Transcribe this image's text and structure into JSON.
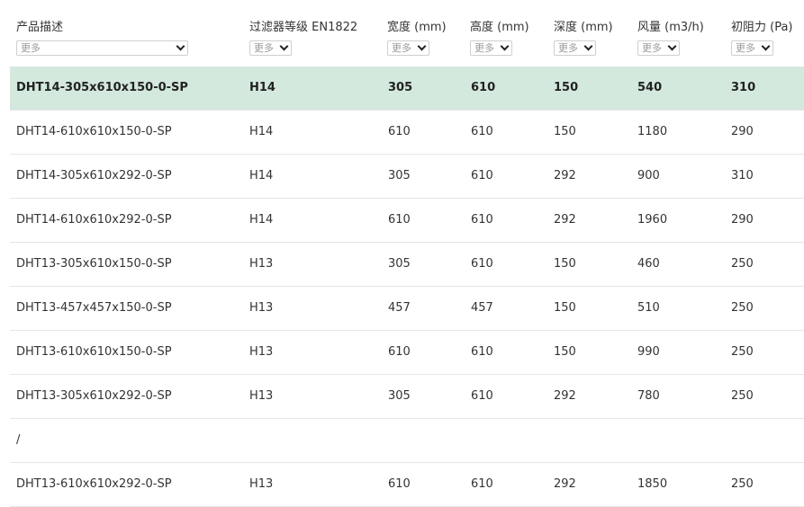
{
  "columns": [
    {
      "title": "产品描述",
      "filter": "更多"
    },
    {
      "title": "过滤器等级 EN1822",
      "filter": "更多"
    },
    {
      "title": "宽度 (mm)",
      "filter": "更多"
    },
    {
      "title": "高度 (mm)",
      "filter": "更多"
    },
    {
      "title": "深度 (mm)",
      "filter": "更多"
    },
    {
      "title": "风量 (m3/h)",
      "filter": "更多"
    },
    {
      "title": "初阻力 (Pa)",
      "filter": "更多"
    }
  ],
  "rows": [
    [
      "DHT14-305x610x150-0-SP",
      "H14",
      "305",
      "610",
      "150",
      "540",
      "310"
    ],
    [
      "DHT14-610x610x150-0-SP",
      "H14",
      "610",
      "610",
      "150",
      "1180",
      "290"
    ],
    [
      "DHT14-305x610x292-0-SP",
      "H14",
      "305",
      "610",
      "292",
      "900",
      "310"
    ],
    [
      "DHT14-610x610x292-0-SP",
      "H14",
      "610",
      "610",
      "292",
      "1960",
      "290"
    ],
    [
      "DHT13-305x610x150-0-SP",
      "H13",
      "305",
      "610",
      "150",
      "460",
      "250"
    ],
    [
      "DHT13-457x457x150-0-SP",
      "H13",
      "457",
      "457",
      "150",
      "510",
      "250"
    ],
    [
      "DHT13-610x610x150-0-SP",
      "H13",
      "610",
      "610",
      "150",
      "990",
      "250"
    ],
    [
      "DHT13-305x610x292-0-SP",
      "H13",
      "305",
      "610",
      "292",
      "780",
      "250"
    ]
  ],
  "separator": "/",
  "last_row": [
    "DHT13-610x610x292-0-SP",
    "H13",
    "610",
    "610",
    "292",
    "1850",
    "250"
  ],
  "colors": {
    "highlight": "#d3e9de",
    "border": "#e6e6e6"
  }
}
